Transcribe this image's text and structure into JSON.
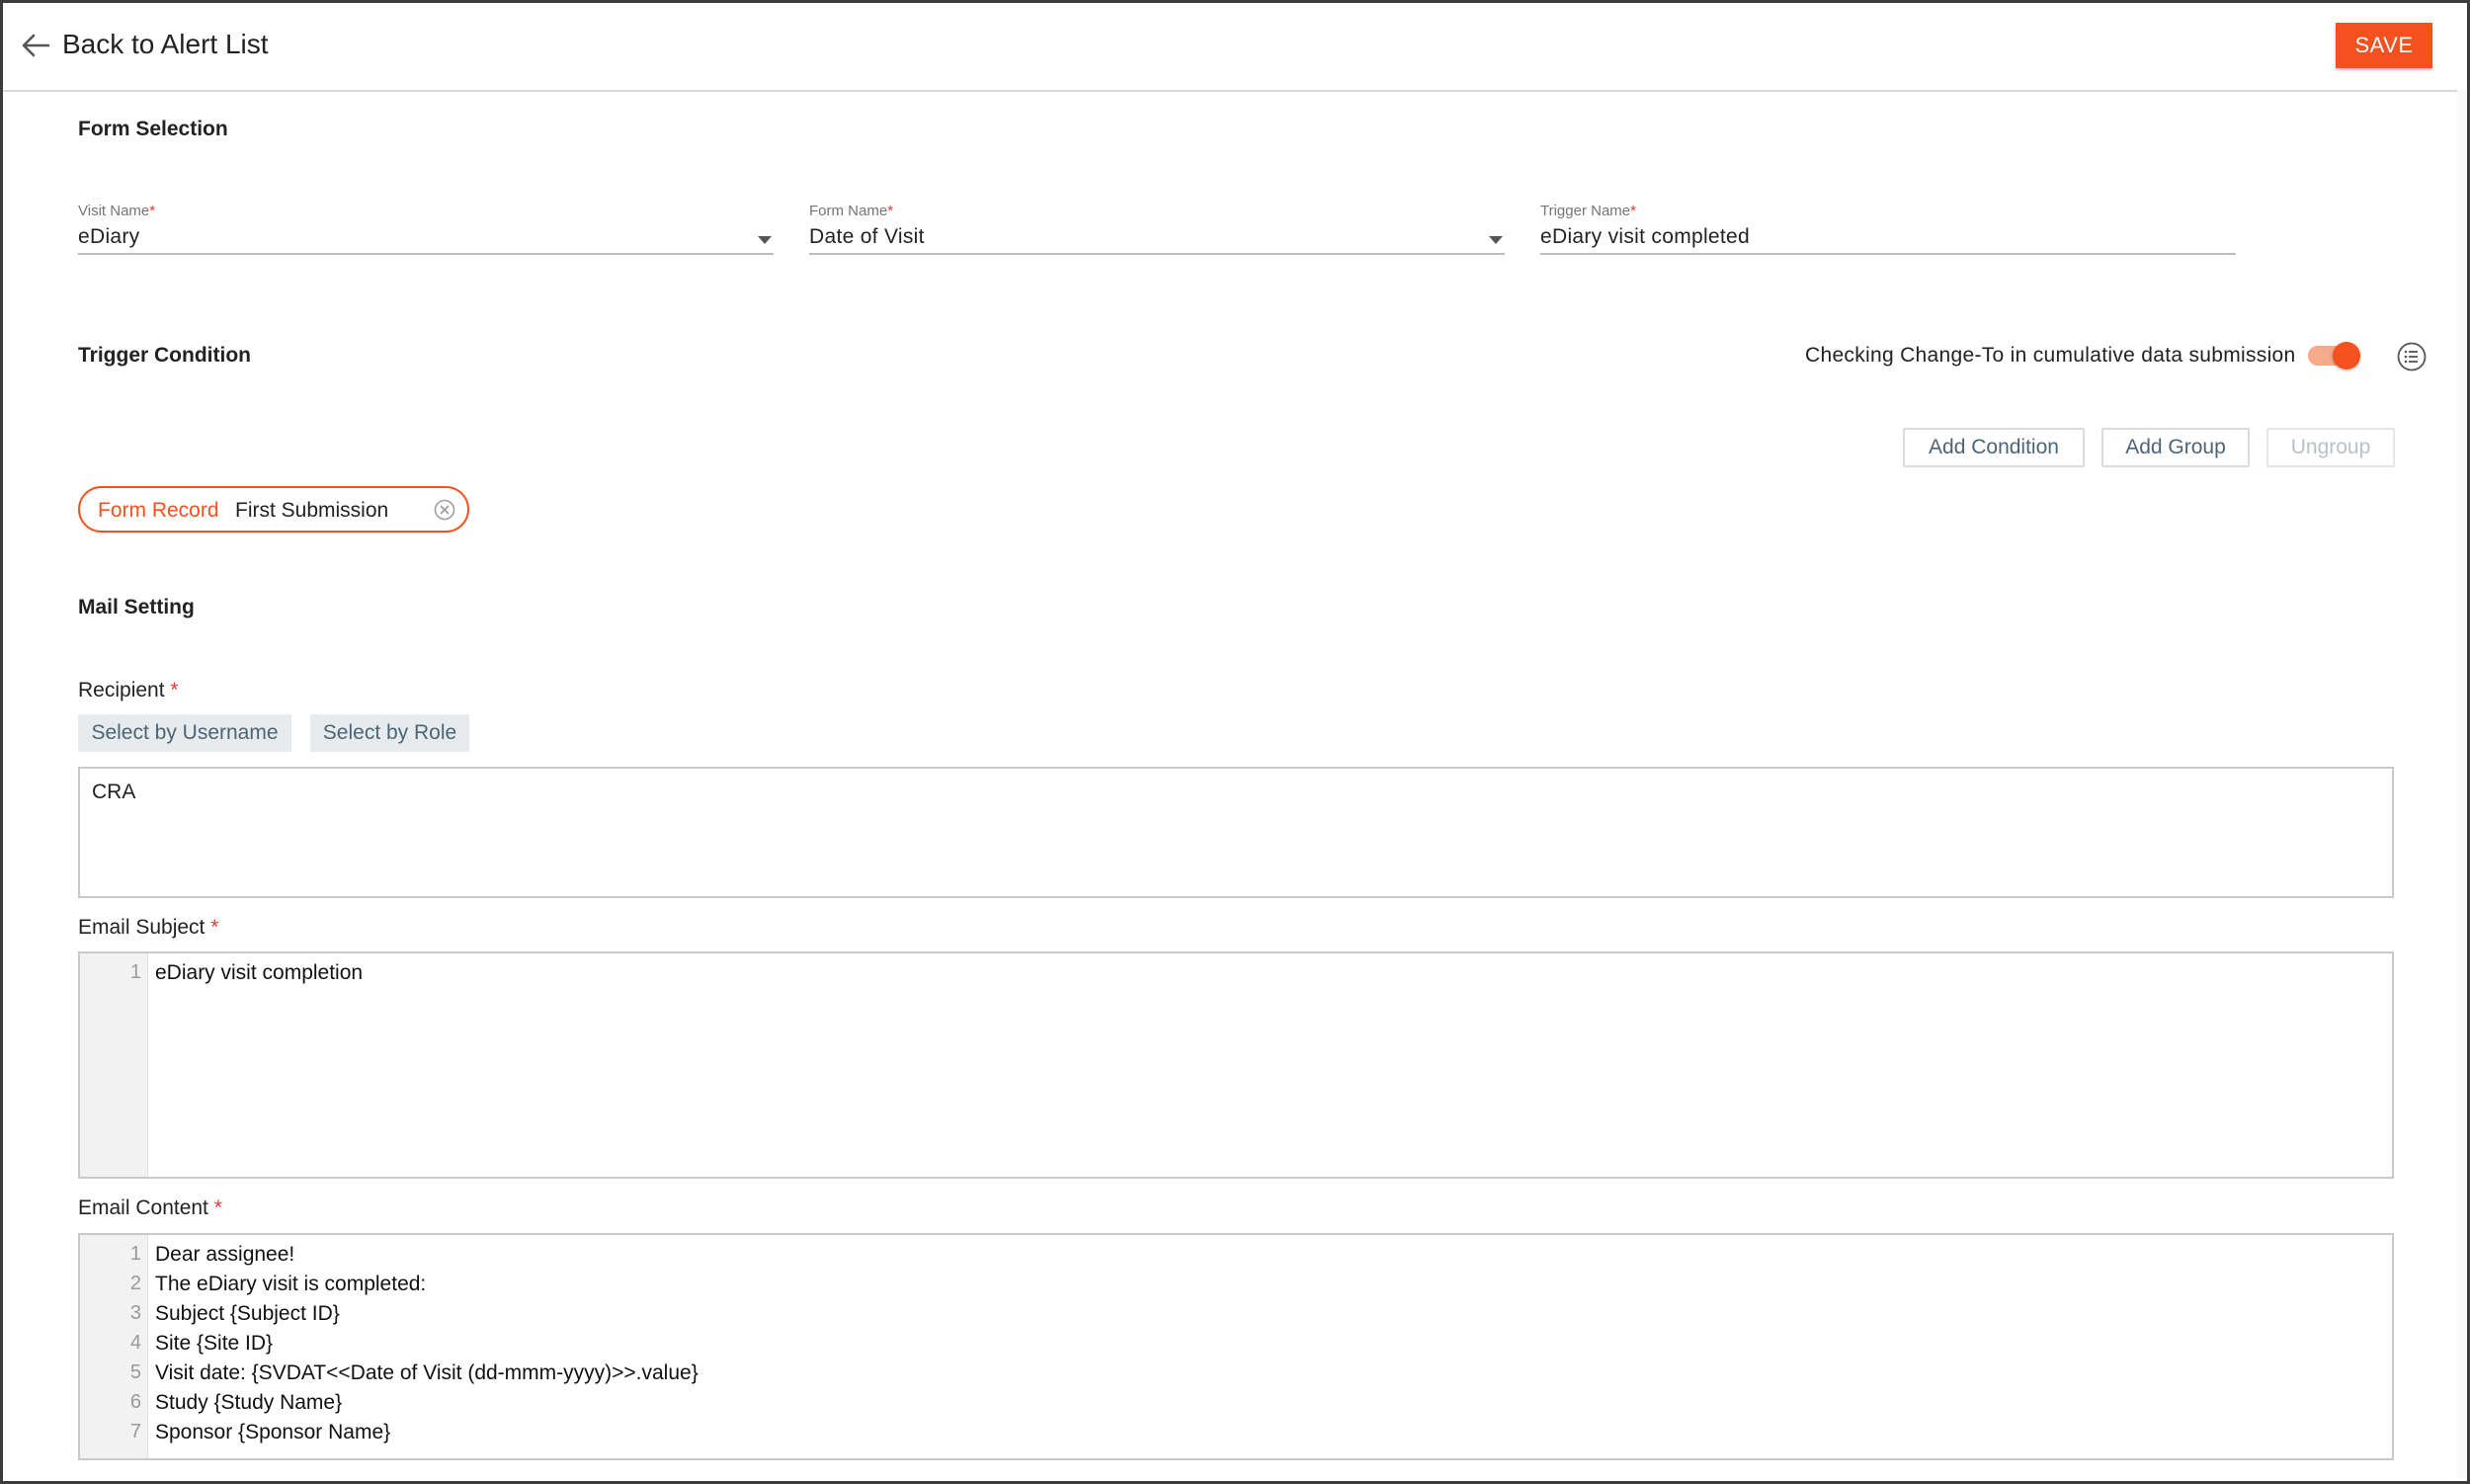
{
  "header": {
    "back_label": "Back to Alert List",
    "save_label": "SAVE"
  },
  "form_selection": {
    "title": "Form Selection",
    "visit_name": {
      "label": "Visit Name",
      "value": "eDiary"
    },
    "form_name": {
      "label": "Form Name",
      "value": "Date of Visit"
    },
    "trigger_name": {
      "label": "Trigger Name",
      "value": "eDiary visit completed"
    },
    "required_mark": "*"
  },
  "trigger_condition": {
    "title": "Trigger Condition",
    "toggle_label": "Checking Change-To in cumulative data submission",
    "toggle_on": true,
    "add_condition": "Add Condition",
    "add_group": "Add Group",
    "ungroup": "Ungroup",
    "chip": {
      "key": "Form Record",
      "value": "First Submission"
    }
  },
  "mail_setting": {
    "title": "Mail Setting",
    "recipient_label": "Recipient",
    "select_by_username": "Select by Username",
    "select_by_role": "Select by Role",
    "recipient_value": "CRA",
    "email_subject_label": "Email Subject",
    "email_subject_lines": [
      {
        "num": "1",
        "text": "eDiary visit completion"
      }
    ],
    "email_content_label": "Email Content",
    "email_content_lines": [
      {
        "num": "1",
        "text": "Dear assignee!"
      },
      {
        "num": "2",
        "text": "The eDiary visit is completed:"
      },
      {
        "num": "3",
        "text": "Subject {Subject ID}"
      },
      {
        "num": "4",
        "text": "Site {Site ID}"
      },
      {
        "num": "5",
        "text": "Visit date: {SVDAT<<Date of Visit (dd-mmm-yyyy)>>.value}"
      },
      {
        "num": "6",
        "text": "Study {Study Name}"
      },
      {
        "num": "7",
        "text": "Sponsor {Sponsor Name}"
      }
    ],
    "required_mark": "*"
  },
  "colors": {
    "accent": "#f4511e",
    "button_text": "#4c6576"
  }
}
